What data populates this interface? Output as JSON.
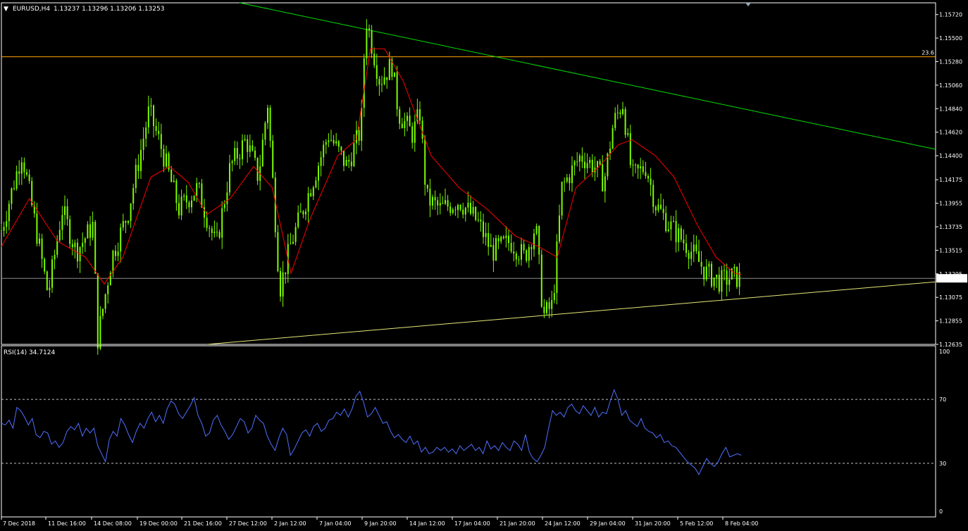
{
  "header": {
    "menu_glyph": "▼",
    "symbol_label": "EURUSD,H4",
    "ohlc_text": "1.13237 1.13296 1.13206 1.13253"
  },
  "rsi_panel": {
    "label_text": "RSI(14) 34.7124",
    "levels": [
      70,
      30
    ],
    "ticks": [
      "100",
      "70",
      "30",
      "0"
    ]
  },
  "colors": {
    "background": "#000000",
    "frame": "#ffffff",
    "candle": "#7cfc00",
    "ma_line": "#ff0000",
    "downtrend_line": "#00e000",
    "uptrend_line": "#e6e67a",
    "fib_line": "#ffa500",
    "bid_line": "#8c8c8c",
    "rsi_line": "#4f6fff",
    "level_line": "#c0c0c0"
  },
  "chart_data": [
    {
      "type": "candlestick",
      "symbol": "EURUSD",
      "timeframe": "H4",
      "last_price": "1.13253",
      "ylim": [
        1.12635,
        1.1583
      ],
      "y_ticks": [
        "1.15720",
        "1.15500",
        "1.15280",
        "1.15060",
        "1.14840",
        "1.14620",
        "1.14400",
        "1.14175",
        "1.13955",
        "1.13735",
        "1.13515",
        "1.13295",
        "1.13075",
        "1.12855",
        "1.12635"
      ],
      "x_ticks": [
        "7 Dec 2018",
        "11 Dec 16:00",
        "14 Dec 08:00",
        "19 Dec 00:00",
        "21 Dec 16:00",
        "27 Dec 12:00",
        "2 Jan 12:00",
        "7 Jan 04:00",
        "9 Jan 20:00",
        "14 Jan 12:00",
        "17 Jan 04:00",
        "21 Jan 20:00",
        "24 Jan 12:00",
        "29 Jan 04:00",
        "31 Jan 20:00",
        "5 Feb 12:00",
        "8 Feb 04:00"
      ],
      "horizontal_lines": [
        {
          "name": "fib",
          "price": 1.15325,
          "label": "23.6"
        },
        {
          "name": "bid",
          "price": 1.13253,
          "label": "1.13253"
        }
      ],
      "trendlines": [
        {
          "name": "downtrend",
          "from": [
            0.255,
            1.1583
          ],
          "to": [
            1.0,
            1.1446
          ]
        },
        {
          "name": "uptrend",
          "from": [
            0.22,
            1.12635
          ],
          "to": [
            1.0,
            1.1322
          ]
        }
      ],
      "price_path": [
        [
          0.0,
          1.137
        ],
        [
          0.022,
          1.1443
        ],
        [
          0.05,
          1.131
        ],
        [
          0.065,
          1.139
        ],
        [
          0.08,
          1.135
        ],
        [
          0.098,
          1.1375
        ],
        [
          0.103,
          1.1268
        ],
        [
          0.118,
          1.1345
        ],
        [
          0.135,
          1.1385
        ],
        [
          0.158,
          1.1482
        ],
        [
          0.172,
          1.1445
        ],
        [
          0.19,
          1.139
        ],
        [
          0.21,
          1.141
        ],
        [
          0.23,
          1.1355
        ],
        [
          0.245,
          1.143
        ],
        [
          0.262,
          1.1455
        ],
        [
          0.275,
          1.142
        ],
        [
          0.285,
          1.149
        ],
        [
          0.298,
          1.1315
        ],
        [
          0.31,
          1.1358
        ],
        [
          0.33,
          1.1408
        ],
        [
          0.35,
          1.146
        ],
        [
          0.37,
          1.143
        ],
        [
          0.385,
          1.1465
        ],
        [
          0.39,
          1.157
        ],
        [
          0.395,
          1.155
        ],
        [
          0.405,
          1.151
        ],
        [
          0.418,
          1.1525
        ],
        [
          0.425,
          1.148
        ],
        [
          0.44,
          1.146
        ],
        [
          0.448,
          1.148
        ],
        [
          0.455,
          1.14
        ],
        [
          0.47,
          1.139
        ],
        [
          0.49,
          1.1398
        ],
        [
          0.51,
          1.1378
        ],
        [
          0.525,
          1.135
        ],
        [
          0.545,
          1.136
        ],
        [
          0.56,
          1.1345
        ],
        [
          0.572,
          1.1375
        ],
        [
          0.58,
          1.129
        ],
        [
          0.59,
          1.13
        ],
        [
          0.6,
          1.141
        ],
        [
          0.62,
          1.144
        ],
        [
          0.635,
          1.143
        ],
        [
          0.645,
          1.1415
        ],
        [
          0.655,
          1.147
        ],
        [
          0.665,
          1.149
        ],
        [
          0.675,
          1.142
        ],
        [
          0.69,
          1.143
        ],
        [
          0.7,
          1.1395
        ],
        [
          0.715,
          1.1375
        ],
        [
          0.735,
          1.1355
        ],
        [
          0.755,
          1.133
        ],
        [
          0.77,
          1.1322
        ],
        [
          0.782,
          1.1327
        ],
        [
          0.792,
          1.1325
        ]
      ],
      "moving_average_path": [
        [
          0.0,
          1.1355
        ],
        [
          0.03,
          1.14
        ],
        [
          0.06,
          1.136
        ],
        [
          0.09,
          1.1345
        ],
        [
          0.11,
          1.132
        ],
        [
          0.13,
          1.1345
        ],
        [
          0.16,
          1.142
        ],
        [
          0.18,
          1.143
        ],
        [
          0.2,
          1.1415
        ],
        [
          0.22,
          1.1385
        ],
        [
          0.245,
          1.14
        ],
        [
          0.27,
          1.143
        ],
        [
          0.29,
          1.141
        ],
        [
          0.31,
          1.133
        ],
        [
          0.33,
          1.138
        ],
        [
          0.36,
          1.144
        ],
        [
          0.38,
          1.1455
        ],
        [
          0.395,
          1.154
        ],
        [
          0.41,
          1.154
        ],
        [
          0.43,
          1.151
        ],
        [
          0.46,
          1.144
        ],
        [
          0.49,
          1.141
        ],
        [
          0.52,
          1.139
        ],
        [
          0.55,
          1.1365
        ],
        [
          0.575,
          1.1355
        ],
        [
          0.595,
          1.1345
        ],
        [
          0.615,
          1.141
        ],
        [
          0.64,
          1.143
        ],
        [
          0.66,
          1.145
        ],
        [
          0.675,
          1.1455
        ],
        [
          0.7,
          1.144
        ],
        [
          0.72,
          1.142
        ],
        [
          0.745,
          1.1375
        ],
        [
          0.765,
          1.1345
        ],
        [
          0.785,
          1.133
        ],
        [
          0.792,
          1.1329
        ]
      ]
    },
    {
      "type": "line",
      "indicator": "RSI(14)",
      "last_value": "34.7124",
      "ylim": [
        0,
        100
      ],
      "levels": [
        70,
        30
      ],
      "series": [
        {
          "values": [
            55,
            54,
            57,
            52,
            65,
            63,
            59,
            54,
            58,
            48,
            46,
            50,
            49,
            42,
            44,
            40,
            43,
            50,
            53,
            51,
            55,
            47,
            52,
            49,
            52,
            41,
            36,
            31,
            45,
            50,
            47,
            58,
            54,
            48,
            43,
            50,
            55,
            52,
            58,
            62,
            56,
            60,
            55,
            64,
            69,
            67,
            61,
            58,
            62,
            66,
            71,
            60,
            55,
            47,
            49,
            57,
            60,
            54,
            50,
            45,
            48,
            53,
            58,
            56,
            49,
            52,
            60,
            57,
            55,
            47,
            42,
            38,
            46,
            52,
            48,
            35,
            39,
            44,
            49,
            51,
            47,
            53,
            55,
            50,
            52,
            57,
            58,
            62,
            60,
            64,
            59,
            64,
            72,
            75,
            68,
            59,
            61,
            65,
            60,
            55,
            56,
            50,
            46,
            48,
            45,
            43,
            47,
            42,
            44,
            37,
            40,
            36,
            37,
            40,
            38,
            40,
            37,
            39,
            36,
            41,
            38,
            40,
            42,
            38,
            40,
            36,
            44,
            39,
            41,
            38,
            43,
            40,
            38,
            44,
            42,
            38,
            48,
            37,
            33,
            31,
            35,
            40,
            52,
            63,
            60,
            62,
            59,
            65,
            67,
            63,
            61,
            66,
            63,
            60,
            65,
            59,
            62,
            61,
            69,
            76,
            70,
            60,
            63,
            57,
            55,
            53,
            58,
            52,
            50,
            49,
            46,
            48,
            43,
            44,
            41,
            40,
            37,
            34,
            31,
            29,
            27,
            23,
            28,
            33,
            30,
            28,
            31,
            36,
            40,
            34,
            35,
            36,
            35
          ]
        }
      ]
    }
  ]
}
